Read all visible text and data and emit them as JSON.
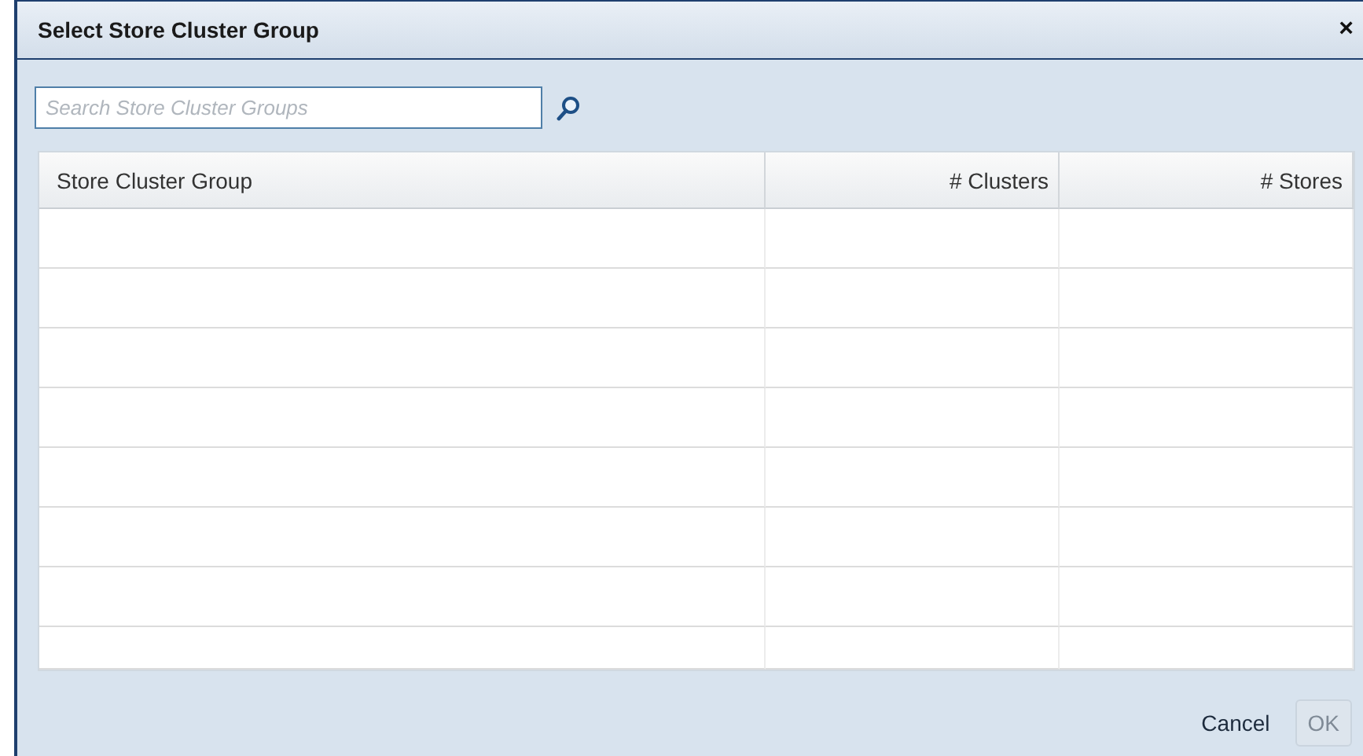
{
  "window": {
    "title": "Select Store Cluster Group",
    "close": "×"
  },
  "search": {
    "placeholder": "Search Store Cluster Groups"
  },
  "table": {
    "columns": [
      {
        "label": "Store Cluster Group"
      },
      {
        "label": "# Clusters"
      },
      {
        "label": "# Stores"
      }
    ]
  },
  "buttons": [
    {
      "label": "Cancel",
      "disabled": false
    },
    {
      "label": "OK",
      "disabled": true
    }
  ]
}
